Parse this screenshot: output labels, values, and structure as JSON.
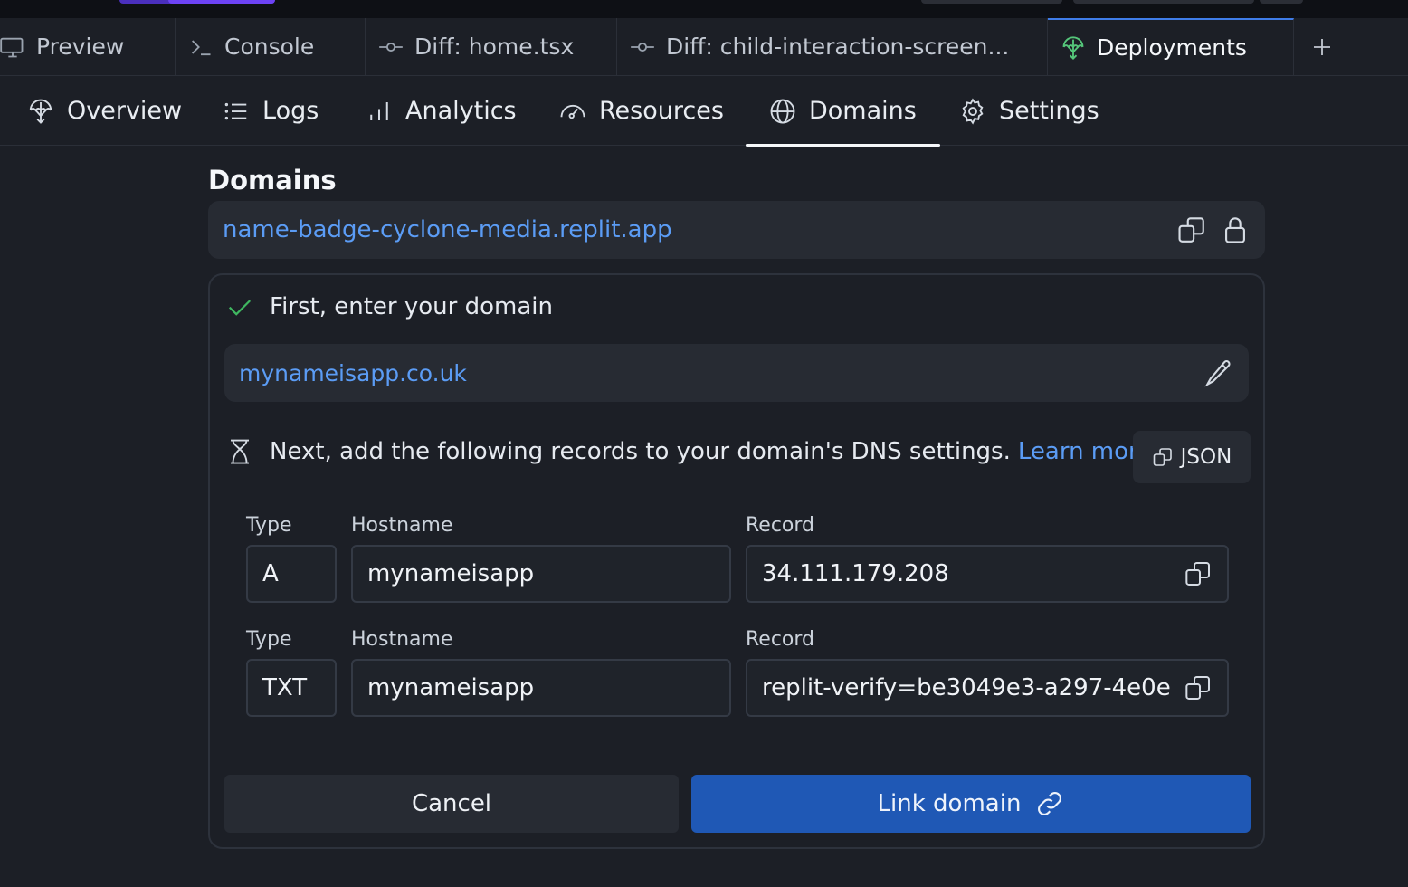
{
  "tabs": [
    {
      "label": "Preview",
      "icon": "monitor-icon"
    },
    {
      "label": "Console",
      "icon": "terminal-icon"
    },
    {
      "label": "Diff: home.tsx",
      "icon": "git-commit-icon"
    },
    {
      "label": "Diff: child-interaction-screen...",
      "icon": "git-commit-icon"
    },
    {
      "label": "Deployments",
      "icon": "deployments-icon",
      "active": true
    }
  ],
  "add_tab_icon": "plus-icon",
  "subnav": [
    {
      "label": "Overview",
      "icon": "deployments-icon"
    },
    {
      "label": "Logs",
      "icon": "list-icon"
    },
    {
      "label": "Analytics",
      "icon": "bar-chart-icon"
    },
    {
      "label": "Resources",
      "icon": "gauge-icon"
    },
    {
      "label": "Domains",
      "icon": "globe-icon",
      "active": true
    },
    {
      "label": "Settings",
      "icon": "gear-icon"
    }
  ],
  "domains": {
    "title": "Domains",
    "default_url": "name-badge-cyclone-media.replit.app"
  },
  "steps": {
    "first": "First, enter your domain",
    "domain_value": "mynameisapp.co.uk",
    "next": "Next, add the following records to your domain's DNS settings.",
    "learn_more": "Learn more",
    "json_label": "JSON"
  },
  "records": [
    {
      "type_label": "Type",
      "hostname_label": "Hostname",
      "record_label": "Record",
      "type": "A",
      "hostname": "mynameisapp",
      "record": "34.111.179.208"
    },
    {
      "type_label": "Type",
      "hostname_label": "Hostname",
      "record_label": "Record",
      "type": "TXT",
      "hostname": "mynameisapp",
      "record": "replit-verify=be3049e3-a297-4e0e"
    }
  ],
  "actions": {
    "cancel": "Cancel",
    "link": "Link domain"
  },
  "colors": {
    "background": "#1c1f26",
    "link": "#5b9cf5",
    "primary_button": "#1f58b5",
    "success": "#3fb760",
    "active_tab_icon": "#55c67a"
  }
}
